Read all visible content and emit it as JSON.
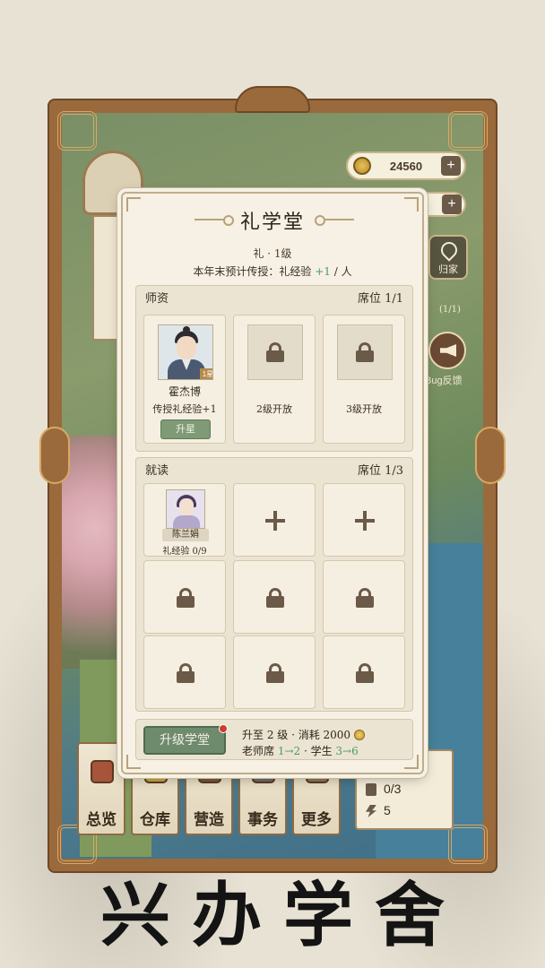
{
  "hud": {
    "coins": "24560",
    "plus": "+",
    "home_label": "归家",
    "bug_label": "Bug反馈",
    "seat_mini": "(1/1)"
  },
  "dialog": {
    "title": "礼学堂",
    "level_text": "礼 · 1级",
    "forecast_prefix": "本年末预计传授：礼经验 ",
    "forecast_value": "+1",
    "forecast_suffix": " / 人",
    "teachers": {
      "header": "师资",
      "seats": "席位 1/1",
      "teacher": {
        "name": "霍杰博",
        "star": "1星",
        "desc": "传授礼经验+1",
        "button": "升星"
      },
      "locked_slots": [
        "2级开放",
        "3级开放"
      ]
    },
    "students": {
      "header": "就读",
      "seats": "席位 1/3",
      "student": {
        "name": "陈兰娟",
        "exp": "礼经验 0/9"
      }
    },
    "upgrade": {
      "button": "升级学堂",
      "line1_prefix": "升至 2 级 · 消耗 ",
      "cost": "2000",
      "line2_a": "老师席 ",
      "line2_a_val": "1→2",
      "line2_b": " · 学生 ",
      "line2_b_val": "3→6"
    }
  },
  "bottom_nav": {
    "tabs": [
      "总览",
      "仓库",
      "营造",
      "事务",
      "更多"
    ]
  },
  "stats": {
    "corner": "三",
    "people": "0/3",
    "energy": "5"
  },
  "banner": "兴办学舍",
  "colors": {
    "frame": "#9a6a3c",
    "accent_green": "#4f9a63",
    "button_green": "#6f8b6e",
    "alert_red": "#d23a2a"
  }
}
